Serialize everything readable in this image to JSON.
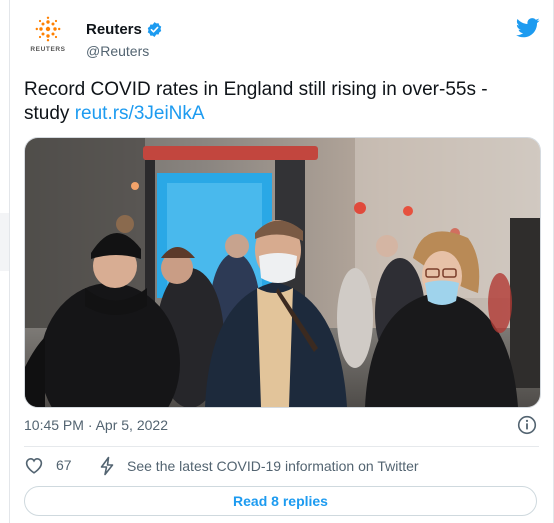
{
  "author": {
    "display_name": "Reuters",
    "handle": "@Reuters",
    "avatar_wordmark": "REUTERS"
  },
  "tweet": {
    "text": "Record COVID rates in England still rising in over-55s - study",
    "link": "reut.rs/3JeiNkA",
    "timestamp": "10:45 PM · Apr 5, 2022"
  },
  "actions": {
    "like_count": "67",
    "covid_info": "See the latest COVID-19 information on Twitter"
  },
  "replies": {
    "label": "Read 8 replies"
  },
  "icons": {
    "brand": "twitter-bird-icon",
    "verified": "verified-badge-icon",
    "info": "info-icon",
    "like": "heart-icon",
    "covid": "lightning-icon"
  },
  "colors": {
    "accent": "#1d9bf0",
    "text": "#0f1419",
    "muted": "#536471",
    "reuters_orange": "#ff8000"
  }
}
